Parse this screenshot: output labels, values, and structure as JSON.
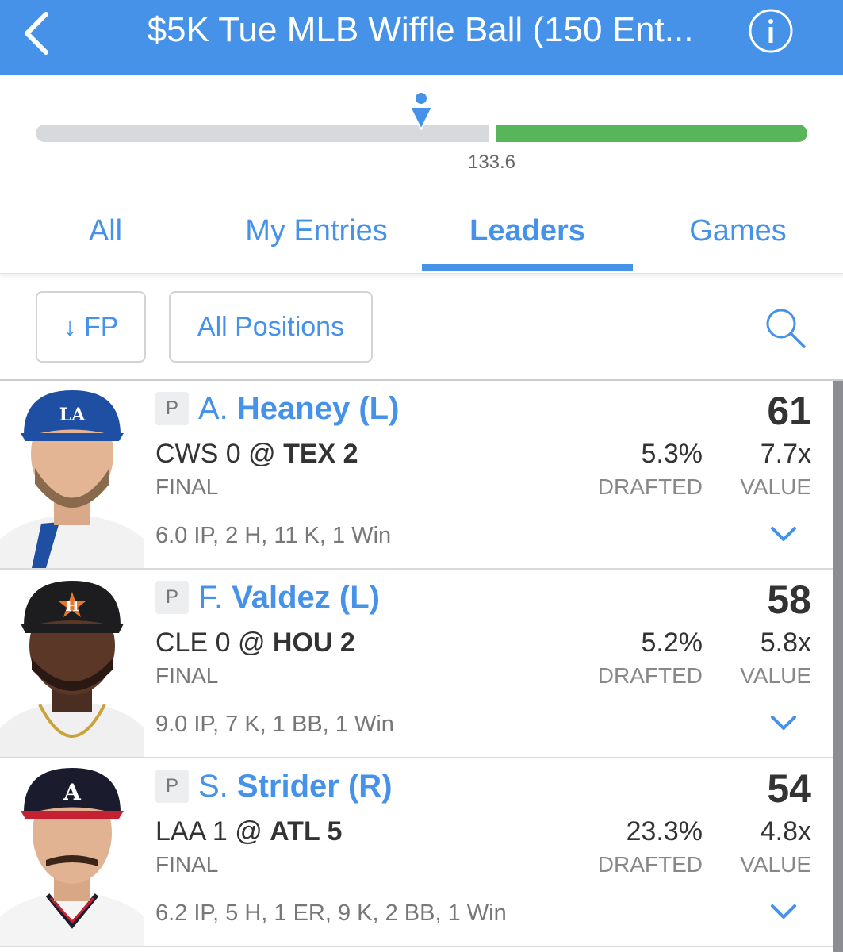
{
  "header": {
    "title": "$5K Tue MLB Wiffle Ball (150 Ent...",
    "back_icon": "chevron-left-icon",
    "info_icon": "info-icon",
    "color": "#4592e8"
  },
  "progress": {
    "label": "133.6",
    "marker_position": 0.5,
    "gray_color": "#d7dadd",
    "green_color": "#59b559"
  },
  "tabs": [
    {
      "label": "All",
      "active": false
    },
    {
      "label": "My Entries",
      "active": false
    },
    {
      "label": "Leaders",
      "active": true
    },
    {
      "label": "Games",
      "active": false
    }
  ],
  "filters": {
    "sort_label": "↓ FP",
    "positions_label": "All Positions",
    "search_icon": "search-icon"
  },
  "players": [
    {
      "pos": "P",
      "first": "A.",
      "last": "Heaney",
      "hand": "(L)",
      "away": "CWS 0 @ ",
      "home": "TEX 2",
      "status": "FINAL",
      "stats": "6.0 IP, 2 H, 11 K, 1 Win",
      "fp": "61",
      "drafted": "5.3%",
      "drafted_label": "DRAFTED",
      "value": "7.7x",
      "value_label": "VALUE",
      "team_color": "#1f4fa3"
    },
    {
      "pos": "P",
      "first": "F.",
      "last": "Valdez",
      "hand": "(L)",
      "away": "CLE 0 @ ",
      "home": "HOU 2",
      "status": "FINAL",
      "stats": "9.0 IP, 7 K, 1 BB, 1 Win",
      "fp": "58",
      "drafted": "5.2%",
      "drafted_label": "DRAFTED",
      "value": "5.8x",
      "value_label": "VALUE",
      "team_color": "#1d1d1f"
    },
    {
      "pos": "P",
      "first": "S.",
      "last": "Strider",
      "hand": "(R)",
      "away": "LAA 1 @ ",
      "home": "ATL 5",
      "status": "FINAL",
      "stats": "6.2 IP, 5 H, 1 ER, 9 K, 2 BB, 1 Win",
      "fp": "54",
      "drafted": "23.3%",
      "drafted_label": "DRAFTED",
      "value": "4.8x",
      "value_label": "VALUE",
      "team_color": "#1a1c2e"
    }
  ]
}
